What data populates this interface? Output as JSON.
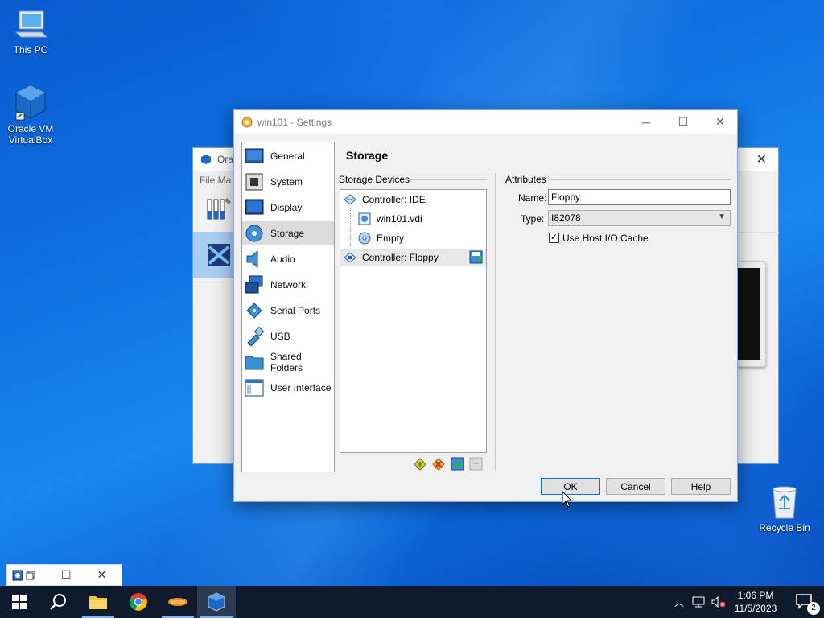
{
  "desktop": {
    "icons": [
      {
        "label": "This PC"
      },
      {
        "label": "Oracle VM VirtualBox"
      },
      {
        "label": "Recycle Bin"
      }
    ]
  },
  "background_window": {
    "title": "Ora",
    "menu": "File   Ma"
  },
  "dialog": {
    "title": "win101 - Settings",
    "heading": "Storage",
    "categories": [
      {
        "label": "General",
        "icon": "general-icon"
      },
      {
        "label": "System",
        "icon": "system-icon"
      },
      {
        "label": "Display",
        "icon": "display-icon"
      },
      {
        "label": "Storage",
        "icon": "storage-icon"
      },
      {
        "label": "Audio",
        "icon": "audio-icon"
      },
      {
        "label": "Network",
        "icon": "network-icon"
      },
      {
        "label": "Serial Ports",
        "icon": "serial-ports-icon"
      },
      {
        "label": "USB",
        "icon": "usb-icon"
      },
      {
        "label": "Shared Folders",
        "icon": "shared-folders-icon"
      },
      {
        "label": "User Interface",
        "icon": "user-interface-icon"
      }
    ],
    "selected_category": "Storage",
    "storage_devices_label": "Storage Devices",
    "tree": {
      "controller_ide": "Controller: IDE",
      "disk": "win101.vdi",
      "optical": "Empty",
      "controller_floppy": "Controller: Floppy"
    },
    "attributes": {
      "group_label": "Attributes",
      "name_label": "Name:",
      "name_value": "Floppy",
      "type_label": "Type:",
      "type_value": "I82078",
      "host_cache_label": "Use Host I/O Cache",
      "host_cache_checked": true,
      "check_mark": "✓"
    },
    "buttons": {
      "ok": "OK",
      "cancel": "Cancel",
      "help": "Help"
    }
  },
  "taskbar": {
    "time": "1:06 PM",
    "date": "11/5/2023",
    "notification_count": "2"
  },
  "colors": {
    "accent": "#0078d7",
    "desktop": "#0d6fe0",
    "taskbar": "#0f1a2c"
  }
}
